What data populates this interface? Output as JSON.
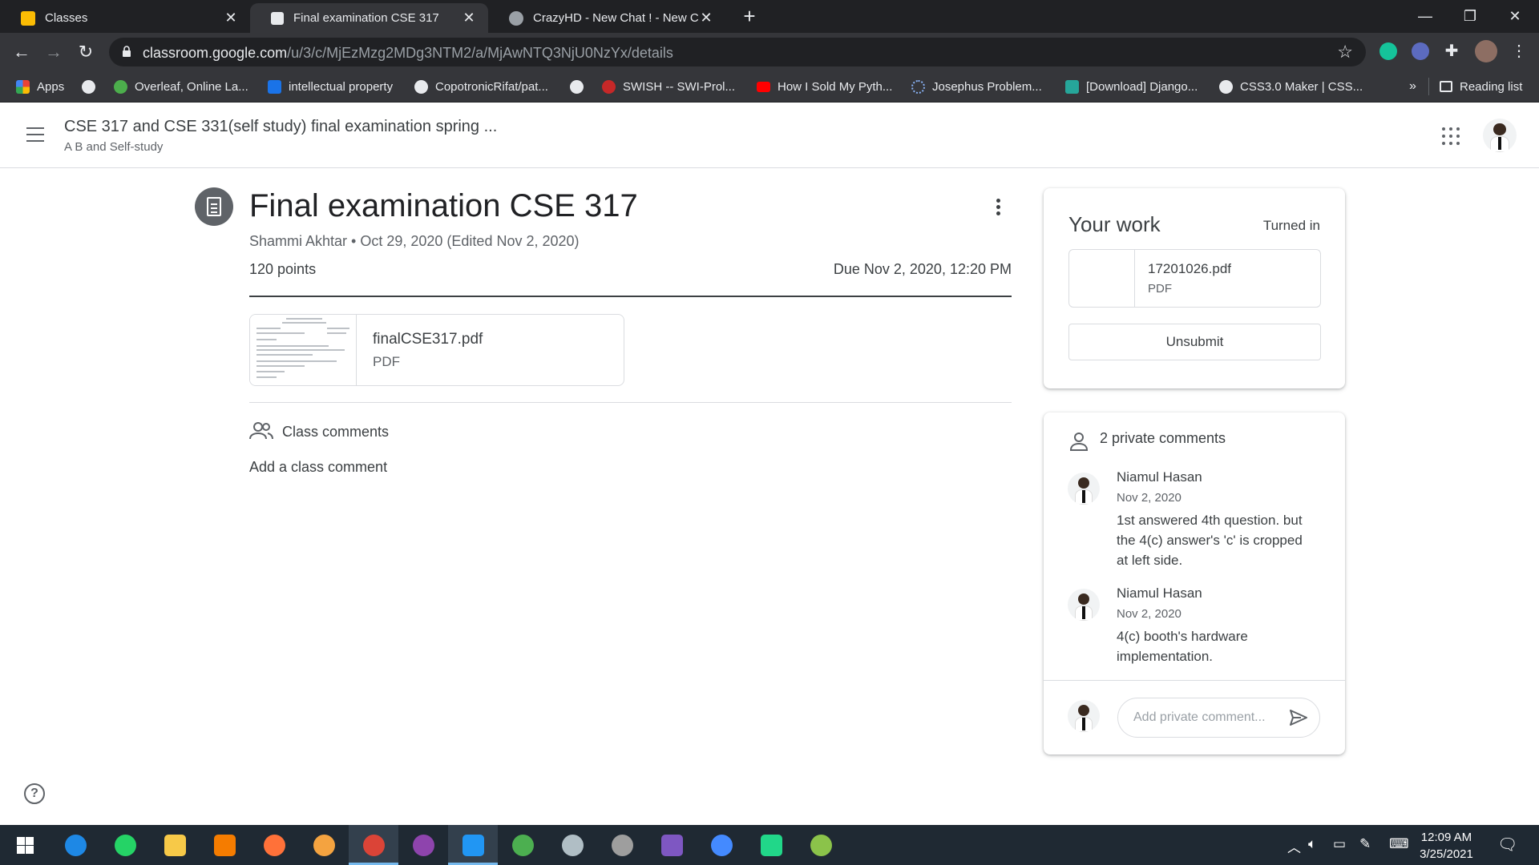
{
  "browser": {
    "tabs": [
      {
        "title": "Classes",
        "favicon": "google-classroom-icon",
        "color": "#fbbc04"
      },
      {
        "title": "Final examination CSE 317",
        "favicon": "assignment-icon",
        "color": "#e8eaed"
      },
      {
        "title": "CrazyHD - New Chat ! - New Cha",
        "favicon": "globe-icon",
        "color": "#9aa0a6"
      }
    ],
    "url_host": "classroom.google.com",
    "url_path": "/u/3/c/MjEzMzg2MDg3NTM2/a/MjAwNTQ3NjU0NzYx/details",
    "bookmarks": [
      {
        "label": "Apps",
        "icon": "apps-grid-icon"
      },
      {
        "label": "",
        "icon": "globe-icon"
      },
      {
        "label": "Overleaf, Online La...",
        "icon": "overleaf-icon"
      },
      {
        "label": "intellectual property",
        "icon": "s-icon"
      },
      {
        "label": "CopotronicRifat/pat...",
        "icon": "github-icon"
      },
      {
        "label": "",
        "icon": "globe-icon"
      },
      {
        "label": "SWISH -- SWI-Prol...",
        "icon": "swish-icon"
      },
      {
        "label": "How I Sold My Pyth...",
        "icon": "youtube-icon"
      },
      {
        "label": "Josephus Problem...",
        "icon": "loading-icon"
      },
      {
        "label": "[Download] Django...",
        "icon": "django-icon"
      },
      {
        "label": "CSS3.0 Maker | CSS...",
        "icon": "globe-icon"
      }
    ],
    "bookmarks_more": "»",
    "reading_list": "Reading list"
  },
  "header": {
    "class_title": "CSE 317 and CSE 331(self study) final examination spring ...",
    "class_subtitle": "A B and Self-study"
  },
  "assignment": {
    "title": "Final examination CSE 317",
    "meta": "Shammi Akhtar • Oct 29, 2020 (Edited Nov 2, 2020)",
    "points": "120 points",
    "due": "Due Nov 2, 2020, 12:20 PM",
    "attachment": {
      "name": "finalCSE317.pdf",
      "type": "PDF"
    },
    "class_comments_label": "Class comments",
    "add_class_comment": "Add a class comment"
  },
  "your_work": {
    "title": "Your work",
    "status": "Turned in",
    "file": {
      "name": "17201026.pdf",
      "type": "PDF"
    },
    "unsubmit_label": "Unsubmit"
  },
  "private_comments": {
    "heading": "2 private comments",
    "items": [
      {
        "author": "Niamul Hasan",
        "date": "Nov 2, 2020",
        "text": "1st answered 4th question. but the 4(c) answer's 'c' is cropped at left side."
      },
      {
        "author": "Niamul Hasan",
        "date": "Nov 2, 2020",
        "text": "4(c) booth's hardware implementation."
      }
    ],
    "input_placeholder": "Add private comment..."
  },
  "help_label": "?",
  "taskbar": {
    "apps": [
      {
        "name": "windows-start-icon",
        "color": "#ffffff"
      },
      {
        "name": "app-icon",
        "color": "#1e88e5"
      },
      {
        "name": "whatsapp-icon",
        "color": "#25d366"
      },
      {
        "name": "file-explorer-icon",
        "color": "#f7c948"
      },
      {
        "name": "avast-icon",
        "color": "#f57c00"
      },
      {
        "name": "firefox-icon",
        "color": "#ff7139"
      },
      {
        "name": "app-icon",
        "color": "#f4a340"
      },
      {
        "name": "chrome-icon",
        "color": "#db4437"
      },
      {
        "name": "github-desktop-icon",
        "color": "#8e44ad"
      },
      {
        "name": "vscode-icon",
        "color": "#2196f3"
      },
      {
        "name": "app-icon",
        "color": "#4caf50"
      },
      {
        "name": "app-icon",
        "color": "#b0bec5"
      },
      {
        "name": "app-icon",
        "color": "#9e9e9e"
      },
      {
        "name": "visual-studio-icon",
        "color": "#7e57c2"
      },
      {
        "name": "messenger-icon",
        "color": "#448aff"
      },
      {
        "name": "pycharm-icon",
        "color": "#21d789"
      },
      {
        "name": "app-icon",
        "color": "#8bc34a"
      }
    ],
    "time": "12:09 AM",
    "date": "3/25/2021"
  }
}
